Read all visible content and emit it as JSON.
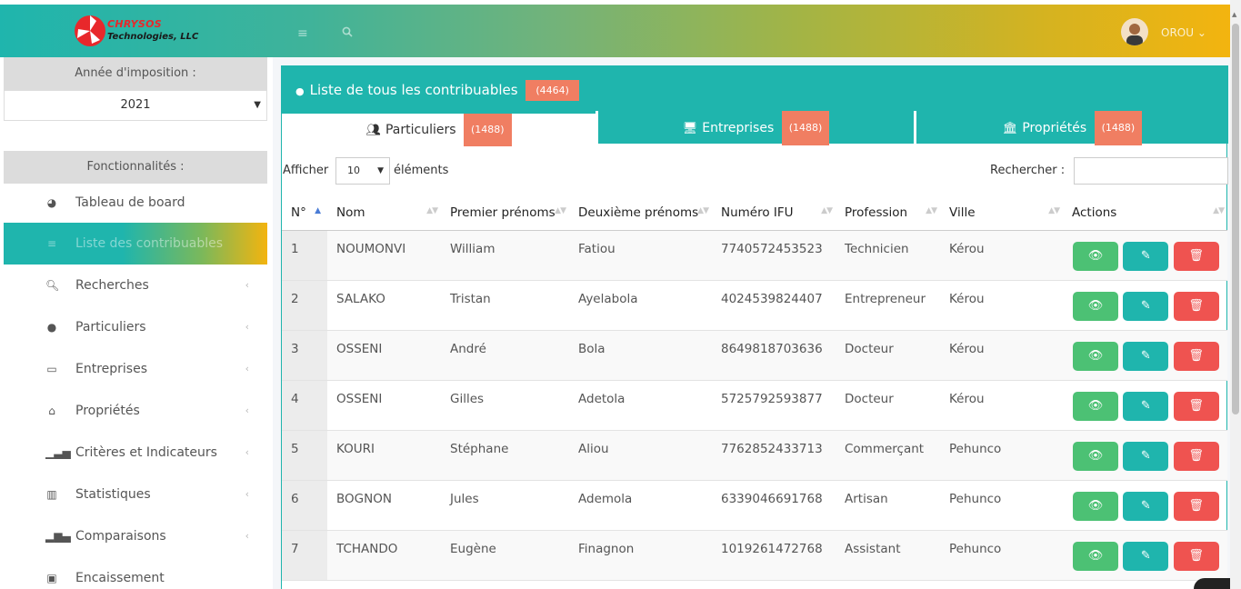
{
  "brand": {
    "title": "CHRYSOS",
    "subtitle": "Technologies, LLC"
  },
  "header": {
    "menu_icon": "hamburger-icon",
    "search_icon": "search-icon",
    "user_name": "OROU",
    "user_caret": "⌄"
  },
  "sidebar": {
    "year_label": "Année d'imposition :",
    "year_value": "2021",
    "features_label": "Fonctionnalités :",
    "items": [
      {
        "label": "Tableau de board",
        "icon": "dashboard-icon",
        "glyph": "◕",
        "chevron": ""
      },
      {
        "label": "Liste des contribuables",
        "icon": "list-icon",
        "glyph": "≡",
        "chevron": "",
        "active": true
      },
      {
        "label": "Recherches",
        "icon": "search-icon",
        "glyph": "🔍︎",
        "chevron": "‹"
      },
      {
        "label": "Particuliers",
        "icon": "user-icon",
        "glyph": "●",
        "chevron": "‹"
      },
      {
        "label": "Entreprises",
        "icon": "desktop-icon",
        "glyph": "▭",
        "chevron": "‹"
      },
      {
        "label": "Propriétés",
        "icon": "home-icon",
        "glyph": "⌂",
        "chevron": "‹"
      },
      {
        "label": "Critères et Indicateurs",
        "icon": "signal-icon",
        "glyph": "▁▃▅",
        "chevron": "‹"
      },
      {
        "label": "Statistiques",
        "icon": "bar-chart-icon",
        "glyph": "▥",
        "chevron": "‹"
      },
      {
        "label": "Comparaisons",
        "icon": "chart-icon",
        "glyph": "▂▆▄",
        "chevron": "‹"
      },
      {
        "label": "Encaissement",
        "icon": "money-icon",
        "glyph": "▣",
        "chevron": ""
      }
    ]
  },
  "panel": {
    "title": "Liste de tous les contribuables",
    "total": "(4464)",
    "tabs": [
      {
        "label": "Particuliers",
        "count": "(1488)",
        "icon": "users-icon",
        "glyph": "👥︎"
      },
      {
        "label": "Entreprises",
        "count": "(1488)",
        "icon": "desktop-icon",
        "glyph": "🖥︎"
      },
      {
        "label": "Propriétés",
        "count": "(1488)",
        "icon": "bank-icon",
        "glyph": "🏛︎"
      }
    ],
    "show_label": "Afficher",
    "page_length": "10",
    "entries_label": "éléments",
    "search_label": "Rechercher :",
    "search_value": ""
  },
  "table": {
    "columns": [
      "N°",
      "Nom",
      "Premier prénoms",
      "Deuxième prénoms",
      "Numéro IFU",
      "Profession",
      "Ville",
      "Actions"
    ],
    "rows": [
      [
        "1",
        "NOUMONVI",
        "William",
        "Fatiou",
        "7740572453523",
        "Technicien",
        "Kérou"
      ],
      [
        "2",
        "SALAKO",
        "Tristan",
        "Ayelabola",
        "4024539824407",
        "Entrepreneur",
        "Kérou"
      ],
      [
        "3",
        "OSSENI",
        "André",
        "Bola",
        "8649818703636",
        "Docteur",
        "Kérou"
      ],
      [
        "4",
        "OSSENI",
        "Gilles",
        "Adetola",
        "5725792593877",
        "Docteur",
        "Kérou"
      ],
      [
        "5",
        "KOURI",
        "Stéphane",
        "Aliou",
        "7762852433713",
        "Commerçant",
        "Pehunco"
      ],
      [
        "6",
        "BOGNON",
        "Jules",
        "Ademola",
        "6339046691768",
        "Artisan",
        "Pehunco"
      ],
      [
        "7",
        "TCHANDO",
        "Eugène",
        "Finagnon",
        "1019261472768",
        "Assistant",
        "Pehunco"
      ]
    ],
    "actions": {
      "view": "👁︎",
      "edit": "✎",
      "delete": "🗑︎"
    }
  }
}
